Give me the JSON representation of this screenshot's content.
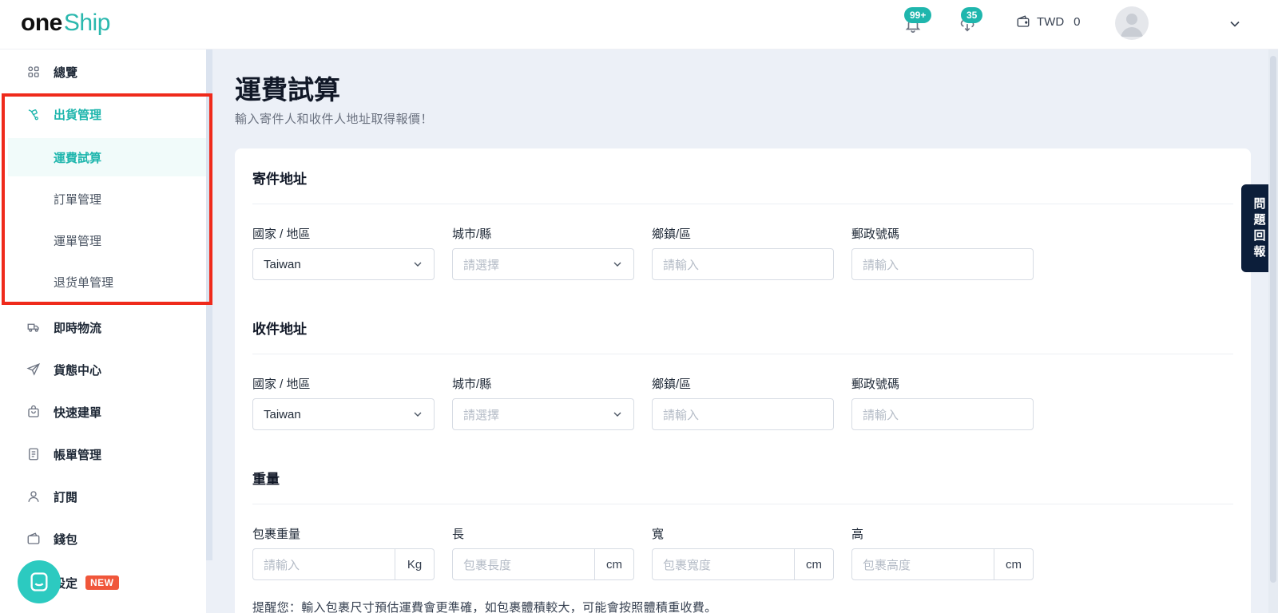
{
  "header": {
    "logo_one": "one",
    "logo_ship": "Ship",
    "notifications_badge": "99+",
    "tasks_badge": "35",
    "currency": "TWD",
    "balance": "0"
  },
  "sidebar": {
    "items": [
      {
        "label": "總覽",
        "icon": "grid-icon"
      },
      {
        "label": "出貨管理",
        "icon": "shipping-icon"
      },
      {
        "label": "即時物流",
        "icon": "truck-icon"
      },
      {
        "label": "貨態中心",
        "icon": "send-icon"
      },
      {
        "label": "快速建單",
        "icon": "bag-icon"
      },
      {
        "label": "帳單管理",
        "icon": "bill-icon"
      },
      {
        "label": "訂閱",
        "icon": "user-icon"
      },
      {
        "label": "錢包",
        "icon": "wallet-icon"
      },
      {
        "label": "設定",
        "icon": "gear-icon",
        "badge": "NEW"
      }
    ],
    "subitems": [
      {
        "label": "運費試算",
        "active": true
      },
      {
        "label": "訂單管理"
      },
      {
        "label": "運單管理"
      },
      {
        "label": "退货单管理"
      }
    ]
  },
  "page": {
    "title": "運費試算",
    "subtitle": "輸入寄件人和收件人地址取得報價！"
  },
  "sender": {
    "title": "寄件地址",
    "country_label": "國家 / 地區",
    "country_value": "Taiwan",
    "city_label": "城市/縣",
    "city_placeholder": "請選擇",
    "district_label": "鄉鎮/區",
    "district_placeholder": "請輸入",
    "zip_label": "郵政號碼",
    "zip_placeholder": "請輸入"
  },
  "receiver": {
    "title": "收件地址",
    "country_label": "國家 / 地區",
    "country_value": "Taiwan",
    "city_label": "城市/縣",
    "city_placeholder": "請選擇",
    "district_label": "鄉鎮/區",
    "district_placeholder": "請輸入",
    "zip_label": "郵政號碼",
    "zip_placeholder": "請輸入"
  },
  "weight": {
    "title": "重量",
    "weight_label": "包裹重量",
    "weight_placeholder": "請輸入",
    "weight_unit": "Kg",
    "length_label": "長",
    "length_placeholder": "包裹長度",
    "width_label": "寬",
    "width_placeholder": "包裹寬度",
    "height_label": "高",
    "height_placeholder": "包裹高度",
    "dim_unit": "cm",
    "note": "提醒您：輸入包裹尺寸預估運費會更準確，如包裹體積較大，可能會按照體積重收費。"
  },
  "feedback": {
    "chars": [
      "問",
      "題",
      "回",
      "報"
    ]
  },
  "colors": {
    "accent": "#1fb6ad",
    "highlight": "#ef2a1b",
    "new_badge": "#f0563a",
    "feedback_bg": "#0c1e3a"
  }
}
